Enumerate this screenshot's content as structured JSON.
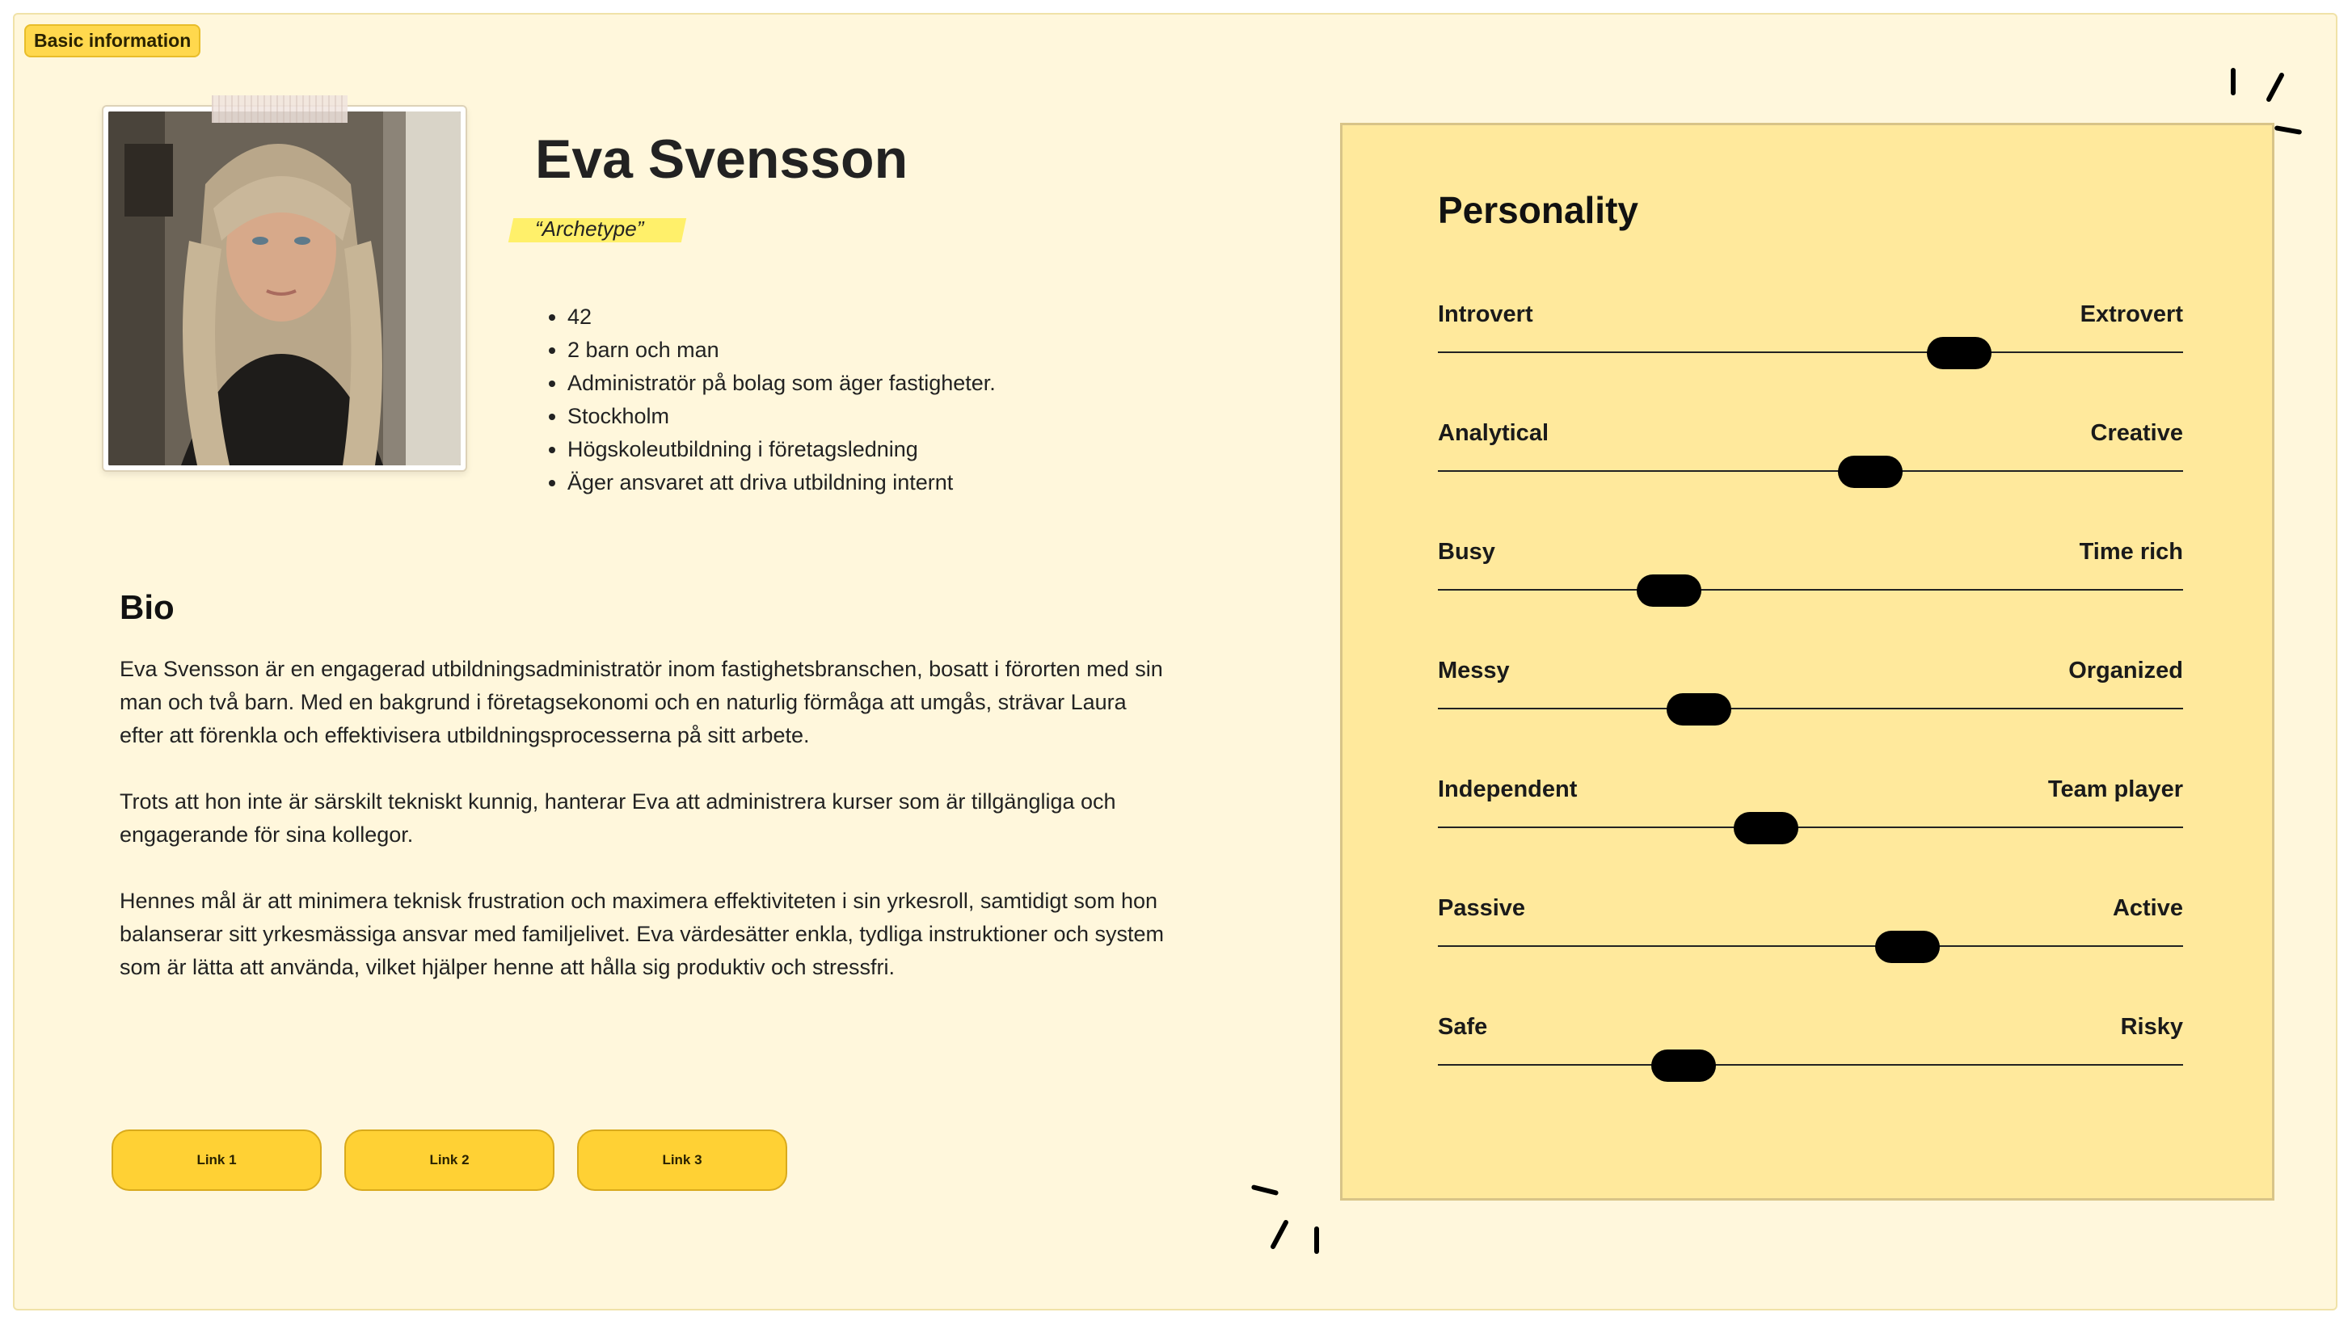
{
  "section_tag": "Basic information",
  "profile": {
    "name": "Eva Svensson",
    "archetype": "“Archetype”",
    "facts": [
      "42",
      "2 barn och man",
      "Administratör på bolag som äger fastigheter.",
      "Stockholm",
      "Högskoleutbildning i företagsledning",
      "Äger ansvaret att driva utbildning internt"
    ]
  },
  "bio": {
    "heading": "Bio",
    "paragraphs": [
      "Eva Svensson är en engagerad utbildningsadministratör inom fastighetsbranschen, bosatt i förorten med sin man och två barn. Med en bakgrund i företagsekonomi och en naturlig förmåga att umgås, strävar Laura efter att förenkla och effektivisera utbildningsprocesserna på sitt arbete.",
      "Trots att hon inte är särskilt tekniskt kunnig, hanterar Eva att administrera kurser som är tillgängliga och engagerande för sina kollegor.",
      "Hennes mål är att minimera teknisk frustration och maximera effektiviteten i sin yrkesroll, samtidigt som hon balanserar sitt yrkesmässiga ansvar med familjelivet. Eva värdesätter enkla, tydliga instruktioner och system som är lätta att använda, vilket hjälper henne att hålla sig produktiv och stressfri."
    ]
  },
  "links": [
    "Link 1",
    "Link 2",
    "Link 3"
  ],
  "personality": {
    "title": "Personality",
    "traits": [
      {
        "left": "Introvert",
        "right": "Extrovert",
        "value": 0.7
      },
      {
        "left": "Analytical",
        "right": "Creative",
        "value": 0.58
      },
      {
        "left": "Busy",
        "right": "Time rich",
        "value": 0.31
      },
      {
        "left": "Messy",
        "right": "Organized",
        "value": 0.35
      },
      {
        "left": "Independent",
        "right": "Team player",
        "value": 0.44
      },
      {
        "left": "Passive",
        "right": "Active",
        "value": 0.63
      },
      {
        "left": "Safe",
        "right": "Risky",
        "value": 0.33
      }
    ]
  },
  "colors": {
    "page_background": "#fff7dc",
    "accent_yellow": "#ffd134",
    "panel_background": "#ffe99c",
    "highlight": "#fff06a",
    "knob": "#000000"
  }
}
